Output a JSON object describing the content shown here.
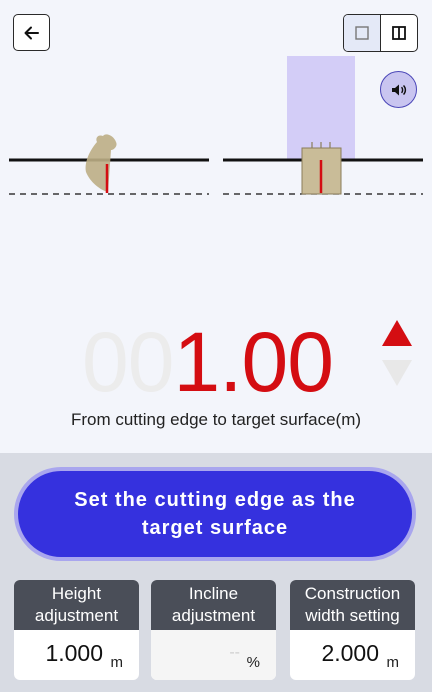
{
  "top_bar": {
    "back_icon": "arrow-left-icon",
    "view_single_icon": "single-square-icon",
    "view_split_icon": "split-square-icon",
    "sound_icon": "speaker-icon"
  },
  "readout": {
    "ghost_digits": "00",
    "value": "1.00",
    "caption": "From cutting edge to target surface(m)",
    "direction": "up",
    "value_color": "#d40d12"
  },
  "actions": {
    "set_target_label": "Set the cutting edge as the target surface",
    "accent": "#3531de"
  },
  "settings": [
    {
      "label": "Height adjustment",
      "value": "1.000",
      "unit": "m",
      "enabled": true
    },
    {
      "label": "Incline adjustment",
      "value": "--",
      "unit": "%",
      "enabled": false
    },
    {
      "label": "Construction width setting",
      "value": "2.000",
      "unit": "m",
      "enabled": true
    }
  ]
}
